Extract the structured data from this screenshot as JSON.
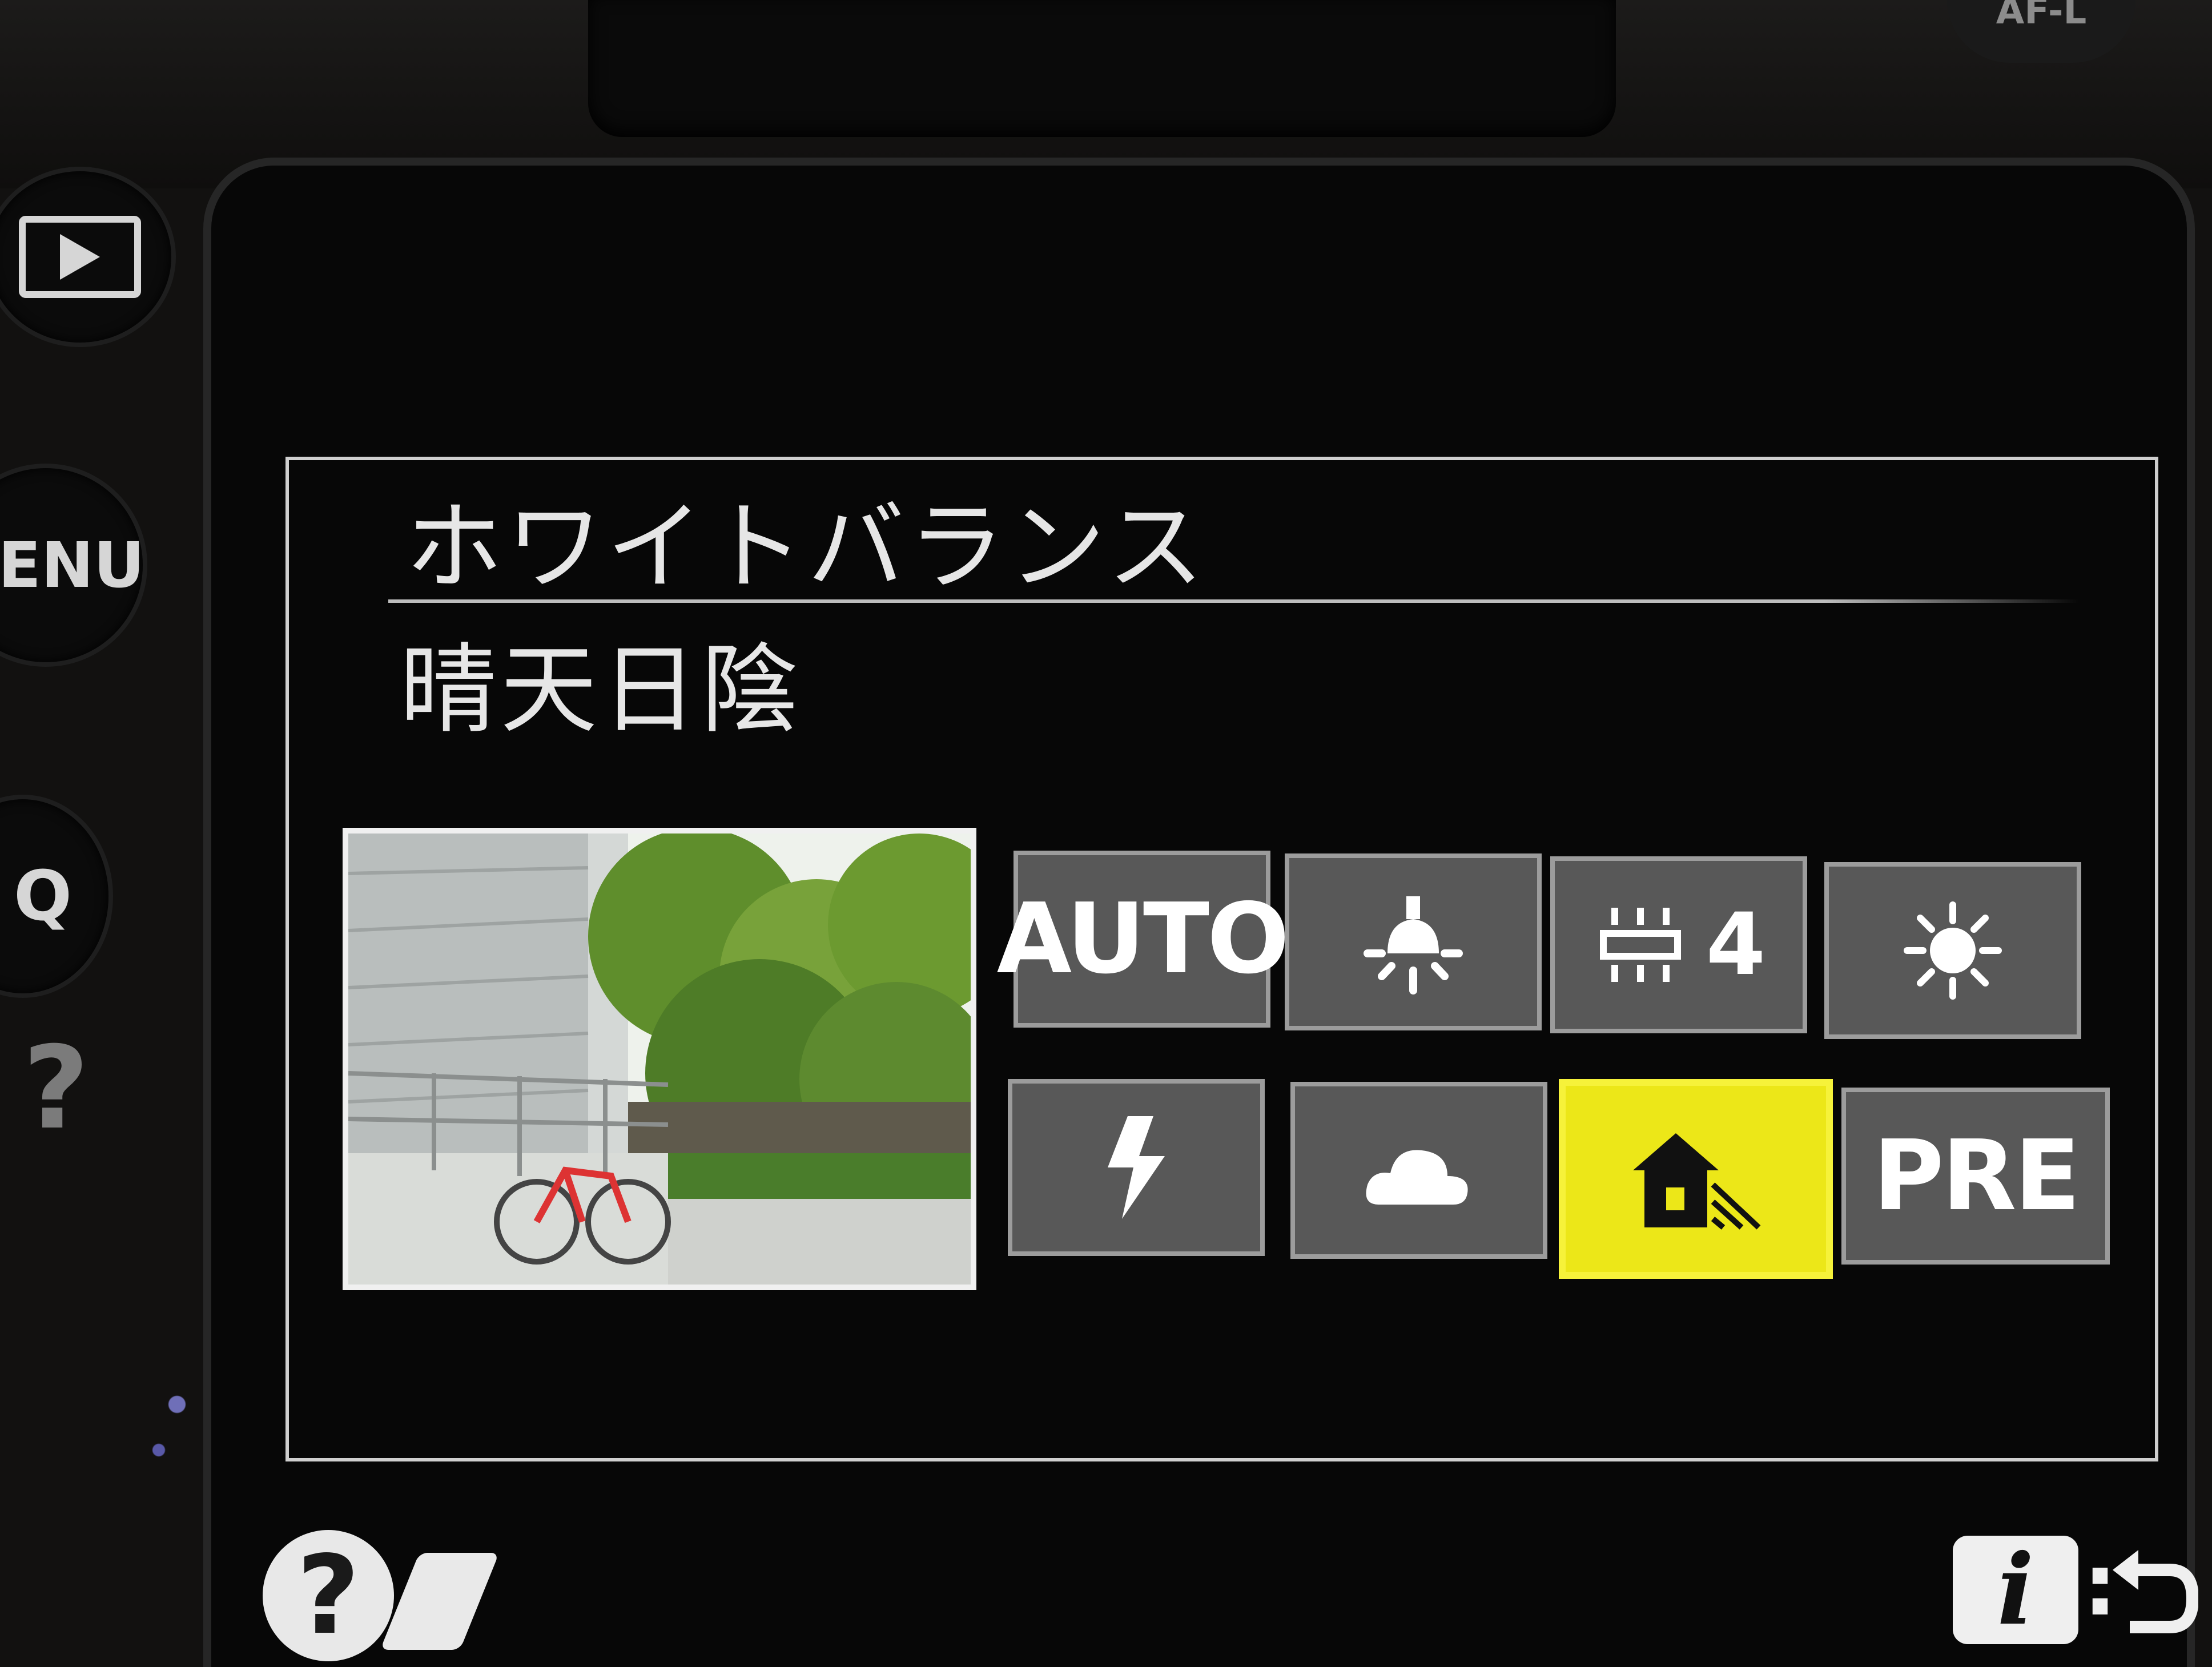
{
  "camera": {
    "top_button_label": "AF-L",
    "menu_button_label": "ENU",
    "zoom_button_label": "Q",
    "side_help_label": "?"
  },
  "menu": {
    "title": "ホワイトバランス",
    "selected_value": "晴天日陰"
  },
  "wb_options": [
    {
      "id": "auto",
      "label": "AUTO",
      "icon": "auto-text",
      "selected": false
    },
    {
      "id": "incandescent",
      "label": "",
      "icon": "incandescent-bulb-icon",
      "selected": false
    },
    {
      "id": "fluorescent",
      "label": "4",
      "icon": "fluorescent-lamp-icon",
      "selected": false
    },
    {
      "id": "daylight",
      "label": "",
      "icon": "sun-icon",
      "selected": false
    },
    {
      "id": "flash",
      "label": "",
      "icon": "flash-icon",
      "selected": false
    },
    {
      "id": "cloudy",
      "label": "",
      "icon": "cloud-icon",
      "selected": false
    },
    {
      "id": "shade",
      "label": "",
      "icon": "shade-house-icon",
      "selected": true
    },
    {
      "id": "preset",
      "label": "PRE",
      "icon": "preset-text",
      "selected": false
    }
  ],
  "footer": {
    "help_label": "?",
    "info_label": "i",
    "info_separator": ":"
  },
  "colors": {
    "selected_tile": "#ece718",
    "tile": "#585858",
    "tile_border": "#9c9c9c",
    "text": "#e6e6e6"
  }
}
